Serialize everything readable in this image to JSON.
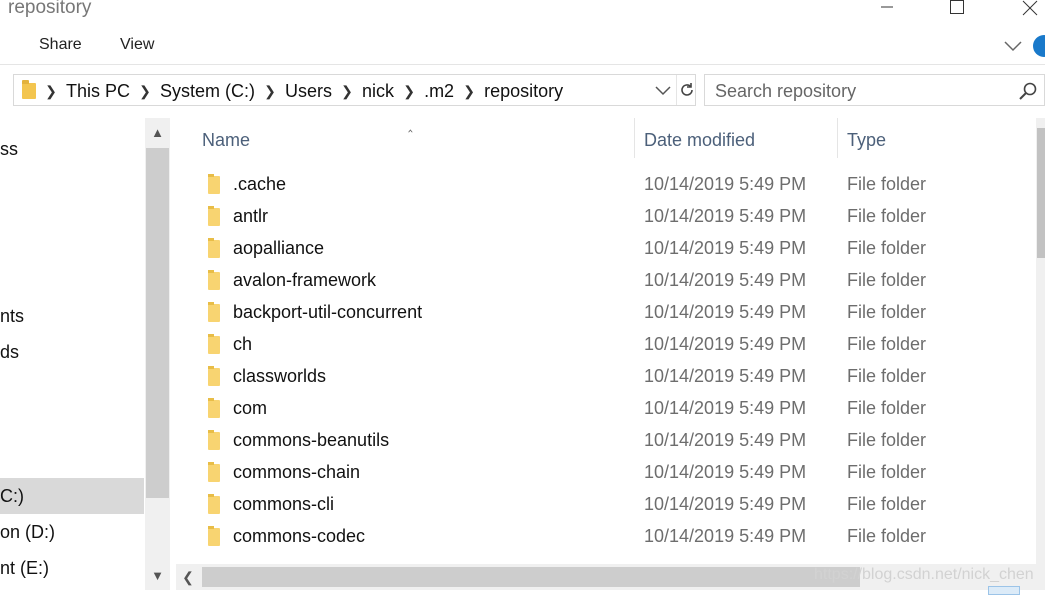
{
  "window": {
    "title": "repository"
  },
  "ribbon": {
    "tabs": [
      "Share",
      "View"
    ]
  },
  "address": {
    "crumbs": [
      "This PC",
      "System (C:)",
      "Users",
      "nick",
      ".m2",
      "repository"
    ]
  },
  "search": {
    "placeholder": "Search repository"
  },
  "nav": {
    "items": [
      {
        "label": "ss"
      },
      {
        "label": "nts"
      },
      {
        "label": "ds"
      },
      {
        "label": "C:)"
      },
      {
        "label": "on (D:)"
      },
      {
        "label": "nt (E:)"
      }
    ]
  },
  "columns": {
    "name": "Name",
    "date": "Date modified",
    "type": "Type"
  },
  "files": [
    {
      "name": ".cache",
      "date": "10/14/2019 5:49 PM",
      "type": "File folder"
    },
    {
      "name": "antlr",
      "date": "10/14/2019 5:49 PM",
      "type": "File folder"
    },
    {
      "name": "aopalliance",
      "date": "10/14/2019 5:49 PM",
      "type": "File folder"
    },
    {
      "name": "avalon-framework",
      "date": "10/14/2019 5:49 PM",
      "type": "File folder"
    },
    {
      "name": "backport-util-concurrent",
      "date": "10/14/2019 5:49 PM",
      "type": "File folder"
    },
    {
      "name": "ch",
      "date": "10/14/2019 5:49 PM",
      "type": "File folder"
    },
    {
      "name": "classworlds",
      "date": "10/14/2019 5:49 PM",
      "type": "File folder"
    },
    {
      "name": "com",
      "date": "10/14/2019 5:49 PM",
      "type": "File folder"
    },
    {
      "name": "commons-beanutils",
      "date": "10/14/2019 5:49 PM",
      "type": "File folder"
    },
    {
      "name": "commons-chain",
      "date": "10/14/2019 5:49 PM",
      "type": "File folder"
    },
    {
      "name": "commons-cli",
      "date": "10/14/2019 5:49 PM",
      "type": "File folder"
    },
    {
      "name": "commons-codec",
      "date": "10/14/2019 5:49 PM",
      "type": "File folder"
    }
  ],
  "watermark": "https://blog.csdn.net/nick_chen",
  "icons": {
    "minimize": "minimize-icon",
    "maximize": "maximize-icon",
    "close": "close-icon",
    "help": "help-icon",
    "folder": "folder-icon",
    "search": "search-icon",
    "refresh": "refresh-icon"
  },
  "colors": {
    "accent": "#1979ca",
    "folder": "#f8d471",
    "header_text": "#4c607a"
  }
}
